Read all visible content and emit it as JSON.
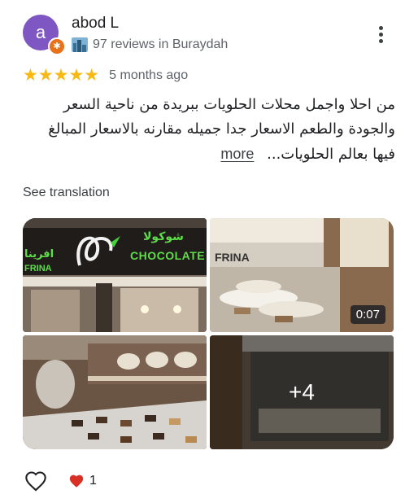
{
  "author": {
    "initial": "a",
    "name": "abod L",
    "meta": "97 reviews in Buraydah"
  },
  "review": {
    "rating": 5,
    "stars": "★★★★★",
    "date": "5 months ago",
    "text": "من احلا واجمل محلات الحلويات ببريدة من ناحية السعر والجودة والطعم الاسعار جدا جميله مقارنه بالاسعار المبالغ فيها بعالم الحلويات...",
    "more_label": "more",
    "translate_label": "See translation"
  },
  "photos": {
    "storefront_sign": {
      "arabic": "افرينا",
      "latin": "FRINA",
      "brand_ar": "شوكولا",
      "brand_en": "CHOCOLATE"
    },
    "video_sign": "FRINA",
    "video_duration": "0:07",
    "more_count": "+4"
  },
  "reactions": {
    "count": "1"
  },
  "colors": {
    "avatar": "#7e57c2",
    "badge": "#e8711a",
    "star": "#f7b916",
    "heart": "#d93025"
  }
}
